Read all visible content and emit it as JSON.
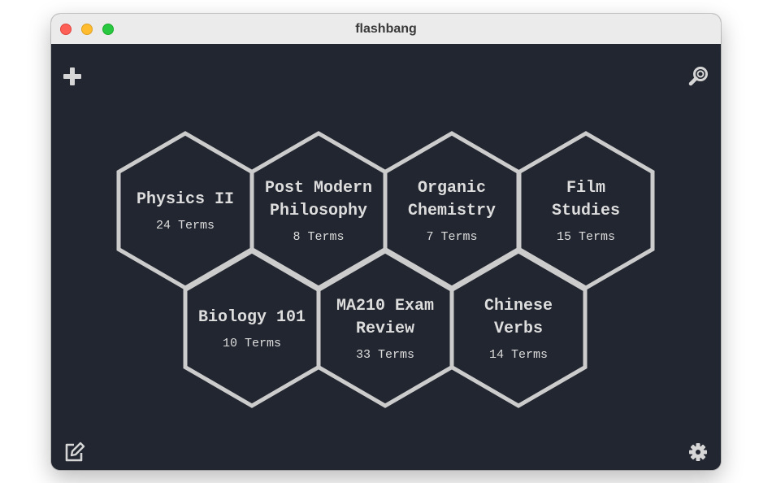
{
  "window": {
    "title": "flashbang"
  },
  "toolbar": {
    "add_icon": "plus-icon",
    "search_icon": "search-icon",
    "edit_icon": "edit-icon",
    "settings_icon": "gear-icon"
  },
  "colors": {
    "background": "#222630",
    "hex_stroke": "#cccccc",
    "text": "#dddddd"
  },
  "decks": [
    {
      "title_lines": [
        "Physics II"
      ],
      "terms": "24 Terms"
    },
    {
      "title_lines": [
        "Post Modern",
        "Philosophy"
      ],
      "terms": "8 Terms"
    },
    {
      "title_lines": [
        "Organic",
        "Chemistry"
      ],
      "terms": "7 Terms"
    },
    {
      "title_lines": [
        "Film",
        "Studies"
      ],
      "terms": "15 Terms"
    },
    {
      "title_lines": [
        "Biology 101"
      ],
      "terms": "10 Terms"
    },
    {
      "title_lines": [
        "MA210 Exam",
        "Review"
      ],
      "terms": "33 Terms"
    },
    {
      "title_lines": [
        "Chinese",
        "Verbs"
      ],
      "terms": "14 Terms"
    }
  ]
}
